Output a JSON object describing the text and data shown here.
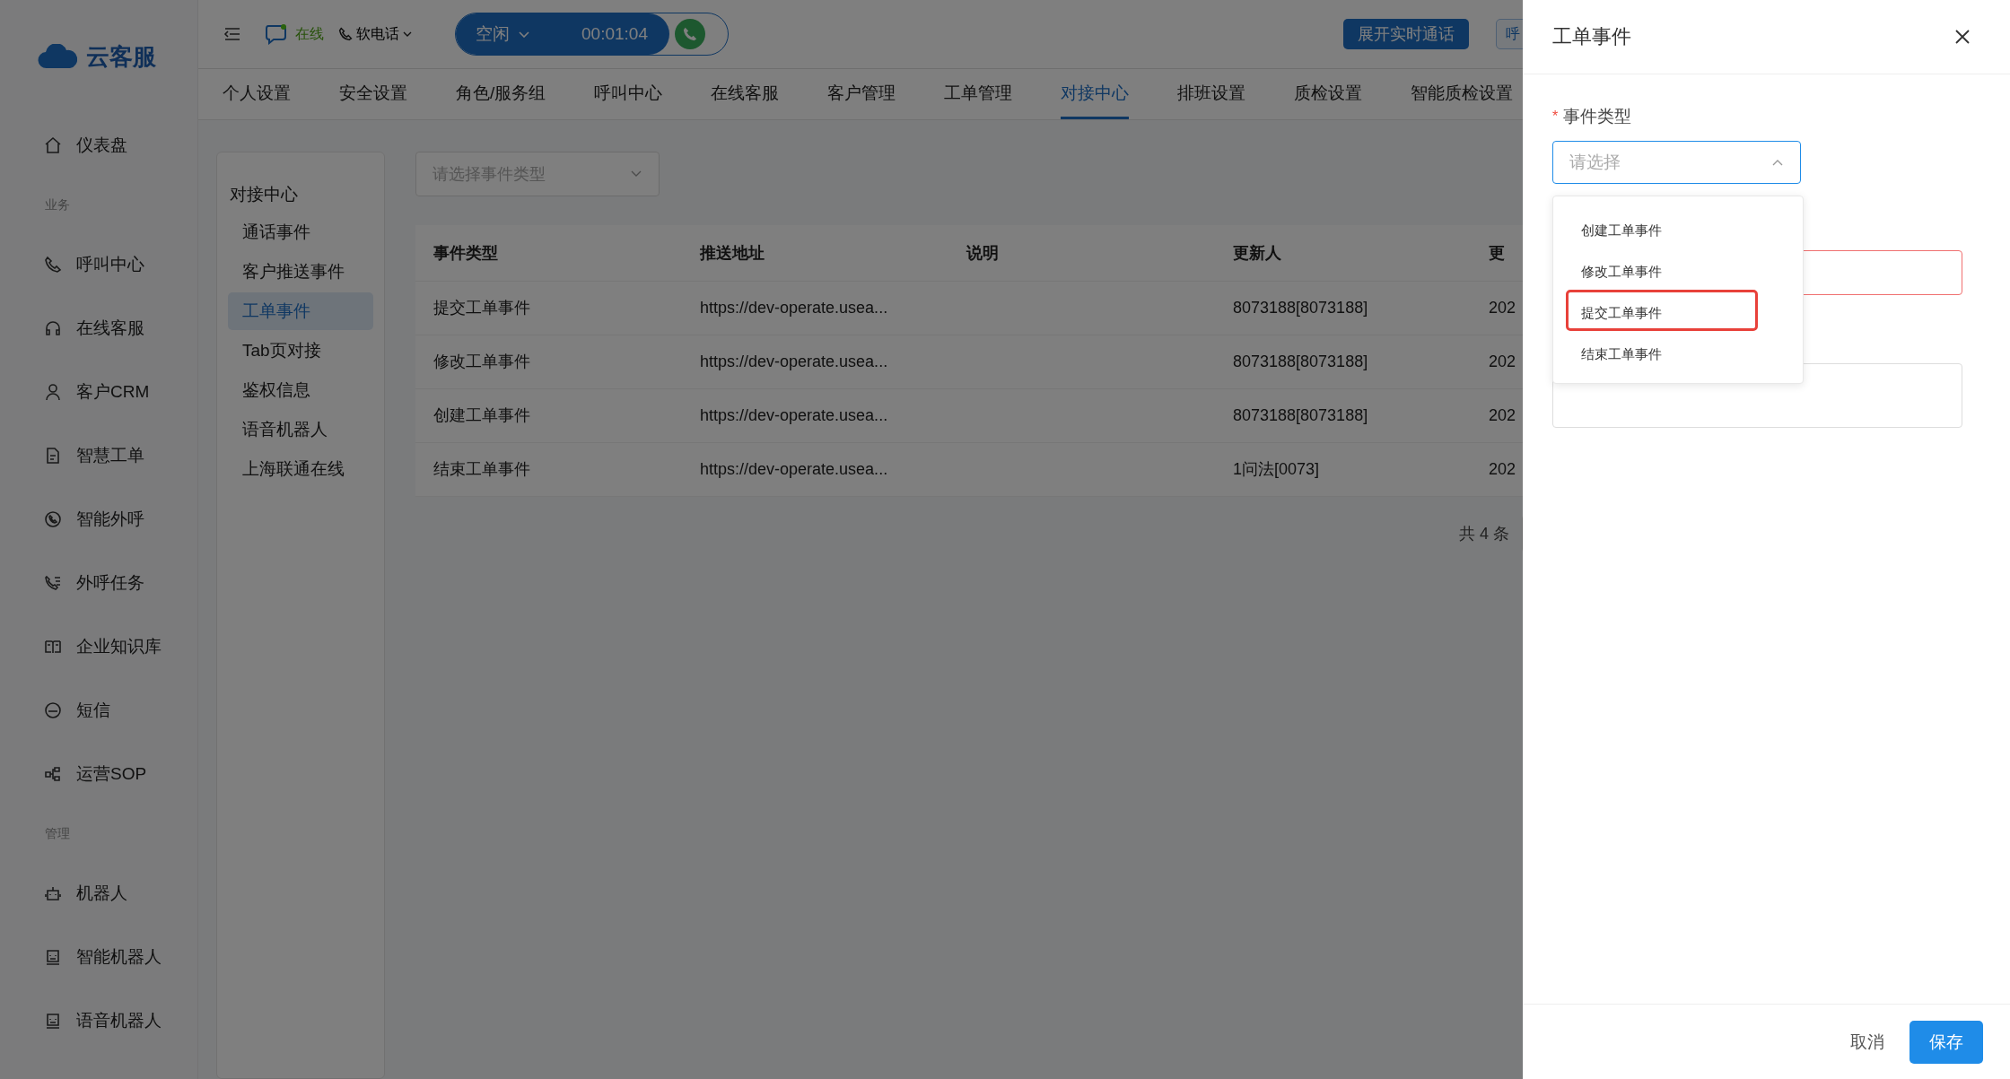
{
  "sidebar": {
    "logo": "云客服",
    "items": [
      {
        "kind": "item",
        "label": "仪表盘",
        "selected": false
      },
      {
        "kind": "section",
        "label": "业务"
      },
      {
        "kind": "item",
        "label": "呼叫中心",
        "selected": false
      },
      {
        "kind": "item",
        "label": "在线客服",
        "selected": false
      },
      {
        "kind": "item",
        "label": "客户CRM",
        "selected": false
      },
      {
        "kind": "item",
        "label": "智慧工单",
        "selected": false
      },
      {
        "kind": "item",
        "label": "智能外呼",
        "selected": false
      },
      {
        "kind": "item",
        "label": "外呼任务",
        "selected": false
      },
      {
        "kind": "item",
        "label": "企业知识库",
        "selected": false
      },
      {
        "kind": "item",
        "label": "短信",
        "selected": false
      },
      {
        "kind": "item",
        "label": "运营SOP",
        "selected": false
      },
      {
        "kind": "section",
        "label": "管理"
      },
      {
        "kind": "item",
        "label": "机器人",
        "selected": false
      },
      {
        "kind": "item",
        "label": "智能机器人",
        "selected": false
      },
      {
        "kind": "item",
        "label": "语音机器人",
        "selected": false
      }
    ]
  },
  "topbar": {
    "status": "在线",
    "phone": "软电话",
    "call_state": "空闲",
    "timer": "00:01:04",
    "buttons": [
      "展开实时通话",
      "呼"
    ]
  },
  "tabs": [
    {
      "label": "个人设置",
      "selected": false
    },
    {
      "label": "安全设置",
      "selected": false
    },
    {
      "label": "角色/服务组",
      "selected": false
    },
    {
      "label": "呼叫中心",
      "selected": false
    },
    {
      "label": "在线客服",
      "selected": false
    },
    {
      "label": "客户管理",
      "selected": false
    },
    {
      "label": "工单管理",
      "selected": false
    },
    {
      "label": "对接中心",
      "selected": true
    },
    {
      "label": "排班设置",
      "selected": false
    },
    {
      "label": "质检设置",
      "selected": false
    },
    {
      "label": "智能质检设置",
      "selected": false
    }
  ],
  "subnav": {
    "title": "对接中心",
    "items": [
      {
        "label": "通话事件",
        "selected": false
      },
      {
        "label": "客户推送事件",
        "selected": false
      },
      {
        "label": "工单事件",
        "selected": true
      },
      {
        "label": "Tab页对接",
        "selected": false
      },
      {
        "label": "鉴权信息",
        "selected": false
      },
      {
        "label": "语音机器人",
        "selected": false
      },
      {
        "label": "上海联通在线",
        "selected": false
      }
    ]
  },
  "filter": {
    "placeholder": "请选择事件类型"
  },
  "table": {
    "columns": [
      "事件类型",
      "推送地址",
      "说明",
      "更新人",
      "更"
    ],
    "rows": [
      [
        "提交工单事件",
        "https://dev-operate.usea...",
        "",
        "8073188[8073188]",
        "202"
      ],
      [
        "修改工单事件",
        "https://dev-operate.usea...",
        "",
        "8073188[8073188]",
        "202"
      ],
      [
        "创建工单事件",
        "https://dev-operate.usea...",
        "",
        "8073188[8073188]",
        "202"
      ],
      [
        "结束工单事件",
        "https://dev-operate.usea...",
        "",
        "1问法[0073]",
        "202"
      ]
    ]
  },
  "pagination": {
    "total": "共 4 条"
  },
  "drawer": {
    "title": "工单事件",
    "field_label": "事件类型",
    "required_mark": "*",
    "select_placeholder": "请选择",
    "open": true,
    "options": [
      {
        "label": "创建工单事件",
        "annotated": false
      },
      {
        "label": "修改工单事件",
        "annotated": false
      },
      {
        "label": "提交工单事件",
        "annotated": true
      },
      {
        "label": "结束工单事件",
        "annotated": false
      }
    ],
    "second_field_error": true,
    "buttons": {
      "cancel": "取消",
      "save": "保存"
    }
  }
}
